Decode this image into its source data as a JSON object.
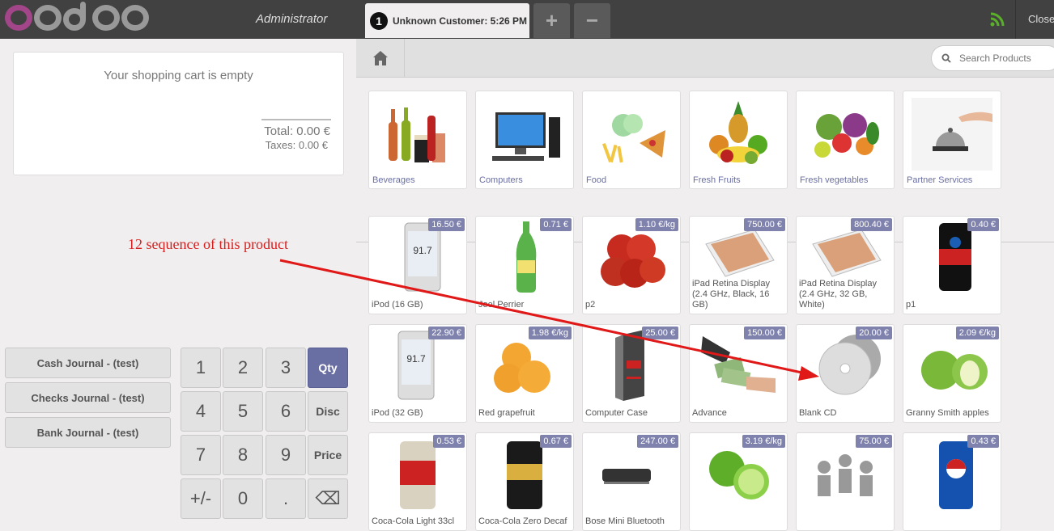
{
  "topbar": {
    "logo_text": "odoo",
    "user": "Administrator",
    "order_number": "1",
    "order_label": "Unknown Customer: 5:26 PM",
    "add_order_icon": "+",
    "remove_order_icon": "−",
    "close_label": "Close"
  },
  "cart": {
    "empty_text": "Your shopping cart is empty",
    "total": "Total: 0.00 €",
    "taxes": "Taxes: 0.00 €"
  },
  "journals": [
    "Cash Journal - (test)",
    "Checks Journal - (test)",
    "Bank Journal - (test)"
  ],
  "numpad": {
    "keys": [
      "1",
      "2",
      "3",
      "4",
      "5",
      "6",
      "7",
      "8",
      "9",
      "+/-",
      "0",
      "."
    ],
    "modes": [
      "Qty",
      "Disc",
      "Price"
    ],
    "backspace_icon": "⌫",
    "active_mode": "Qty"
  },
  "search": {
    "placeholder": "Search Products"
  },
  "categories": [
    "Beverages",
    "Computers",
    "Food",
    "Fresh Fruits",
    "Fresh vegetables",
    "Partner Services"
  ],
  "products": [
    {
      "name": "iPod (16 GB)",
      "price": "16.50 €"
    },
    {
      "name": "Joel Perrier",
      "price": "0.71 €"
    },
    {
      "name": "p2",
      "price": "1.10 €/kg"
    },
    {
      "name": "iPad Retina Display (2.4 GHz, Black, 16 GB)",
      "price": "750.00 €"
    },
    {
      "name": "iPad Retina Display (2.4 GHz, 32 GB, White)",
      "price": "800.40 €"
    },
    {
      "name": "p1",
      "price": "0.40 €"
    },
    {
      "name": "iPod (32 GB)",
      "price": "22.90 €"
    },
    {
      "name": "Red grapefruit",
      "price": "1.98 €/kg"
    },
    {
      "name": "Computer Case",
      "price": "25.00 €"
    },
    {
      "name": "Advance",
      "price": "150.00 €"
    },
    {
      "name": "Blank CD",
      "price": "20.00 €"
    },
    {
      "name": "Granny Smith apples",
      "price": "2.09 €/kg"
    },
    {
      "name": "Coca-Cola Light 33cl",
      "price": "0.53 €"
    },
    {
      "name": "Coca-Cola Zero Decaf",
      "price": "0.67 €"
    },
    {
      "name": "Bose Mini Bluetooth",
      "price": "247.00 €"
    },
    {
      "name": "",
      "price": "3.19 €/kg"
    },
    {
      "name": "",
      "price": "75.00 €"
    },
    {
      "name": "",
      "price": "0.43 €"
    }
  ],
  "annotation": "12 sequence of this product",
  "colors": {
    "topbar": "#414141",
    "accent": "#6a6fa3",
    "annotation": "#d62020"
  }
}
